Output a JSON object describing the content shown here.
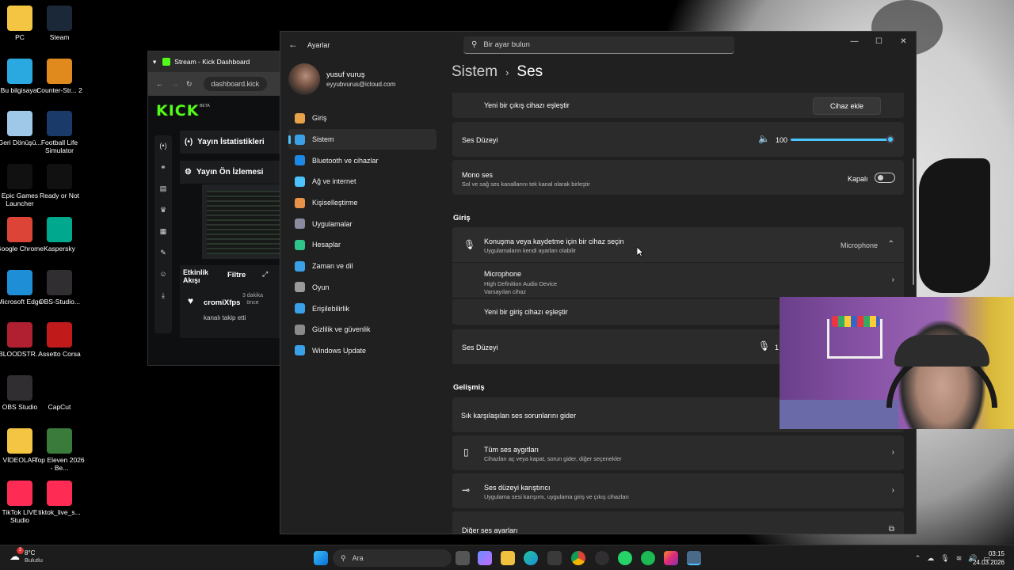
{
  "desktop": {
    "icons": [
      {
        "label": "PC",
        "icon": "folder-icon",
        "color": "#f4c542"
      },
      {
        "label": "Steam",
        "icon": "steam-icon",
        "color": "#1b2838"
      },
      {
        "label": "Bu bilgisayar",
        "icon": "monitor-icon",
        "color": "#2aa8e0"
      },
      {
        "label": "Counter-Str... 2",
        "icon": "cs2-icon",
        "color": "#e08a1e"
      },
      {
        "label": "Geri Dönüşü...",
        "icon": "recycle-bin-icon",
        "color": "#9fc8e8"
      },
      {
        "label": "Football Life Simulator",
        "icon": "fls-icon",
        "color": "#1a3a6a"
      },
      {
        "label": "Epic Games Launcher",
        "icon": "epic-icon",
        "color": "#111111"
      },
      {
        "label": "Ready or Not",
        "icon": "epic-icon",
        "color": "#111111"
      },
      {
        "label": "Google Chrome",
        "icon": "chrome-icon",
        "color": "#db4437"
      },
      {
        "label": "Kaspersky",
        "icon": "kaspersky-icon",
        "color": "#00a88e"
      },
      {
        "label": "Microsoft Edge",
        "icon": "edge-icon",
        "color": "#1e8fd6"
      },
      {
        "label": "OBS-Studio...",
        "icon": "obs-icon",
        "color": "#302e31"
      },
      {
        "label": "BLOODSTR...",
        "icon": "bloodstrike-icon",
        "color": "#b02030"
      },
      {
        "label": "Assetto Corsa",
        "icon": "assetto-icon",
        "color": "#c01a1a"
      },
      {
        "label": "OBS Studio",
        "icon": "obs-icon",
        "color": "#302e31"
      },
      {
        "label": "CapCut",
        "icon": "capcut-icon",
        "color": "#000000"
      },
      {
        "label": "VİDEOLAR",
        "icon": "folder-icon",
        "color": "#f4c542"
      },
      {
        "label": "Top Eleven 2026 - Be...",
        "icon": "top-eleven-icon",
        "color": "#3a7a3a"
      },
      {
        "label": "TikTok LIVE Studio",
        "icon": "tiktok-icon",
        "color": "#fe2c55"
      },
      {
        "label": "tiktok_live_s...",
        "icon": "tiktok-icon",
        "color": "#fe2c55"
      }
    ]
  },
  "browser": {
    "tab_title": "Stream - Kick Dashboard",
    "url": "dashboard.kick",
    "logo": "KICK",
    "logo_badge": "BETA",
    "panel_stats": "Yayın İstatistikleri",
    "panel_preview": "Yayın Ön İzlemesi",
    "feed_title": "Etkinlik Akışı",
    "feed_filter": "Filtre",
    "feed_user": "cromiXfps",
    "feed_action": "kanalı takip etti",
    "feed_time": "3 dakika önce"
  },
  "settings": {
    "app_title": "Ayarlar",
    "search_placeholder": "Bir ayar bulun",
    "user_name": "yusuf vuruş",
    "user_email": "eyyubvurus@icloud.com",
    "breadcrumb_parent": "Sistem",
    "breadcrumb_current": "Ses",
    "nav": [
      {
        "label": "Giriş",
        "icon": "home-icon",
        "color": "#e8a24a"
      },
      {
        "label": "Sistem",
        "icon": "system-icon",
        "color": "#3aa0e8"
      },
      {
        "label": "Bluetooth ve cihazlar",
        "icon": "bluetooth-icon",
        "color": "#1e88e5"
      },
      {
        "label": "Ağ ve internet",
        "icon": "wifi-icon",
        "color": "#4cc2ff"
      },
      {
        "label": "Kişiselleştirme",
        "icon": "brush-icon",
        "color": "#e8924a"
      },
      {
        "label": "Uygulamalar",
        "icon": "apps-icon",
        "color": "#8a8aa0"
      },
      {
        "label": "Hesaplar",
        "icon": "account-icon",
        "color": "#2ec48a"
      },
      {
        "label": "Zaman ve dil",
        "icon": "globe-clock-icon",
        "color": "#3aa0e8"
      },
      {
        "label": "Oyun",
        "icon": "gamepad-icon",
        "color": "#9a9a9a"
      },
      {
        "label": "Erişilebilirlik",
        "icon": "accessibility-icon",
        "color": "#3aa0e8"
      },
      {
        "label": "Gizlilik ve güvenlik",
        "icon": "shield-icon",
        "color": "#8a8a8a"
      },
      {
        "label": "Windows Update",
        "icon": "update-icon",
        "color": "#3aa0e8"
      }
    ],
    "output": {
      "pair_label": "Yeni bir çıkış cihazı eşleştir",
      "add_button": "Cihaz ekle",
      "volume_label": "Ses Düzeyi",
      "volume_value": "100",
      "volume_level": 1.0,
      "mono_title": "Mono ses",
      "mono_desc": "Sol ve sağ ses kanallarını tek kanal olarak birleştir",
      "mono_state": "Kapalı"
    },
    "input": {
      "header": "Giriş",
      "choose_title": "Konuşma veya kaydetme için bir cihaz seçin",
      "choose_desc": "Uygulamaların kendi ayarları olabilir",
      "selected": "Microphone",
      "device_name": "Microphone",
      "device_desc": "High Definition Audio Device",
      "device_default": "Varsayılan cihaz",
      "pair_label": "Yeni bir giriş cihazı eşleştir",
      "volume_label": "Ses Düzeyi",
      "volume_value_partial": "1"
    },
    "advanced": {
      "header": "Gelişmiş",
      "troubleshoot": "Sık karşılaşılan ses sorunlarını gider",
      "all_devices_title": "Tüm ses aygıtları",
      "all_devices_desc": "Cihazları aç veya kapat, sorun gider, diğer seçenekler",
      "mixer_title": "Ses düzeyi karıştırıcı",
      "mixer_desc": "Uygulama sesi karışımı, uygulama giriş ve çıkış cihazları",
      "more_settings": "Diğer ses ayarları"
    }
  },
  "taskbar": {
    "temperature": "8°C",
    "weather": "Bulutlu",
    "search_label": "Ara",
    "time": "03:15",
    "date": "24.03.2026",
    "notification_badge": "2"
  },
  "colors": {
    "accent": "#4cc2ff",
    "kick_green": "#53fc18",
    "window_bg": "#202020",
    "card_bg": "#2b2b2b"
  }
}
